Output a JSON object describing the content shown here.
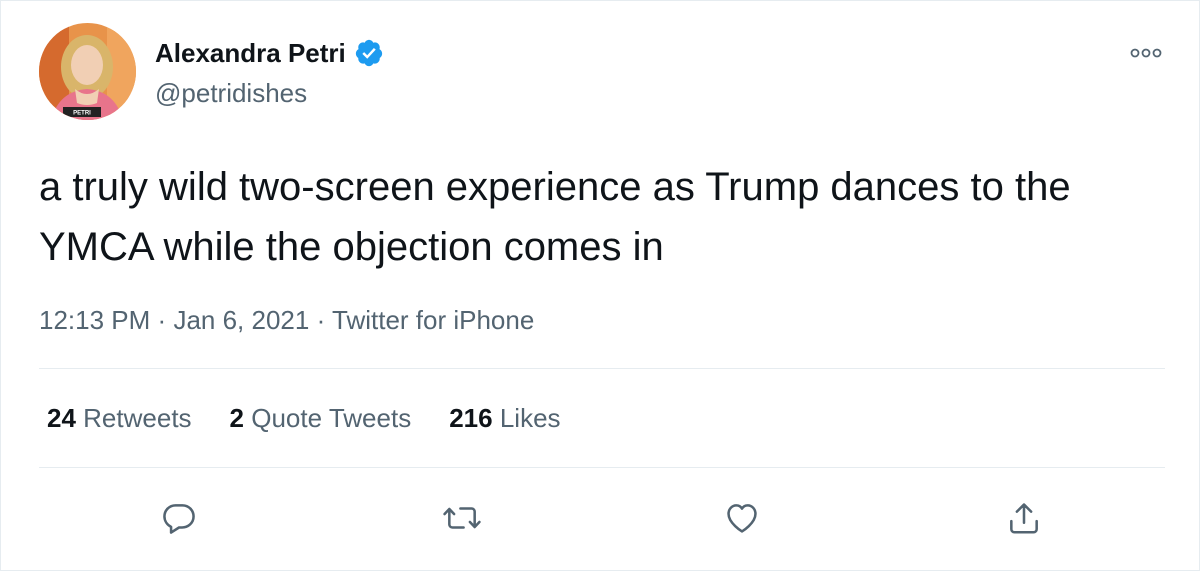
{
  "tweet": {
    "author": {
      "name": "Alexandra Petri",
      "handle": "@petridishes",
      "verified": true,
      "avatar_caption": "PETRI"
    },
    "more_icon": "more-dots-icon",
    "text": "a truly wild two-screen experience as Trump dances to the YMCA while the objection comes in",
    "time": "12:13 PM",
    "date": "Jan 6, 2021",
    "source": "Twitter for iPhone",
    "separator": "·",
    "stats": [
      {
        "count": "24",
        "label": "Retweets"
      },
      {
        "count": "2",
        "label": "Quote Tweets"
      },
      {
        "count": "216",
        "label": "Likes"
      }
    ],
    "actions": [
      {
        "icon": "reply-icon"
      },
      {
        "icon": "retweet-icon"
      },
      {
        "icon": "like-icon"
      },
      {
        "icon": "share-icon"
      }
    ]
  },
  "colors": {
    "text_primary": "#0f1419",
    "text_secondary": "#536471",
    "verified_blue": "#1d9bf0",
    "divider": "#e6ecf0"
  }
}
